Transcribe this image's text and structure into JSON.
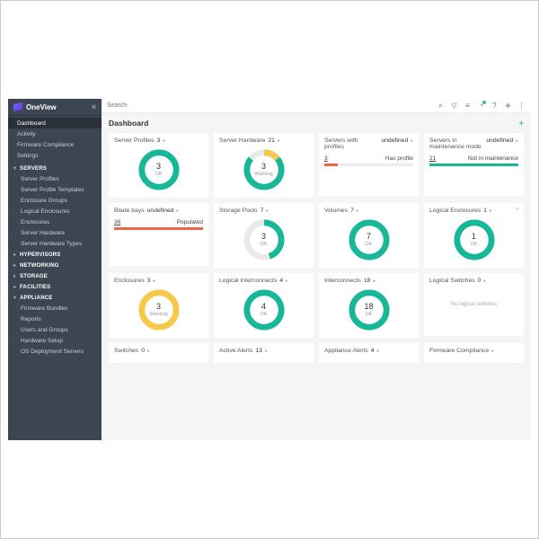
{
  "brand": "OneView",
  "search_placeholder": "Search",
  "topbar_icons": [
    "search-icon",
    "filter-icon",
    "list-icon",
    "alert-icon",
    "help-icon",
    "user-icon",
    "menu-icon"
  ],
  "sidebar": {
    "top": [
      {
        "label": "Dashboard",
        "active": true
      },
      {
        "label": "Activity"
      },
      {
        "label": "Firmware Compliance"
      },
      {
        "label": "Settings"
      }
    ],
    "sections": [
      {
        "label": "Servers",
        "items": [
          "Server Profiles",
          "Server Profile Templates",
          "Enclosure Groups",
          "Logical Enclosures",
          "Enclosures",
          "Server Hardware",
          "Server Hardware Types"
        ]
      },
      {
        "label": "Hypervisors",
        "collapsed": true,
        "items": []
      },
      {
        "label": "Networking",
        "collapsed": true,
        "items": []
      },
      {
        "label": "Storage",
        "collapsed": true,
        "items": []
      },
      {
        "label": "Facilities",
        "collapsed": true,
        "items": []
      },
      {
        "label": "Appliance",
        "items": [
          "Firmware Bundles",
          "Reports",
          "Users and Groups",
          "Hardware Setup",
          "OS Deployment Servers"
        ]
      }
    ]
  },
  "page": {
    "title": "Dashboard"
  },
  "cards": [
    {
      "kind": "ring",
      "title": "Server Profiles",
      "count": 3,
      "num": 3,
      "sub": "OK",
      "ok": 100,
      "wrn": 0
    },
    {
      "kind": "ring",
      "title": "Server Hardware",
      "count": 21,
      "num": 3,
      "sub": "Warning",
      "ok": 86,
      "wrn": 14
    },
    {
      "kind": "flat",
      "title": "Servers with profiles",
      "left_num": 3,
      "right_label": "Has profile",
      "fill_pct": 15,
      "fill_color": "err"
    },
    {
      "kind": "flat",
      "title": "Servers in maintenance mode",
      "left_num": 21,
      "right_label": "Not in maintenance",
      "fill_pct": 100,
      "fill_color": "ok"
    },
    {
      "kind": "flat",
      "title": "Blade bays",
      "left_num": 36,
      "right_label": "Populated",
      "fill_pct": 100,
      "fill_color": "err"
    },
    {
      "kind": "ring",
      "title": "Storage Pools",
      "count": 7,
      "num": 3,
      "sub": "OK",
      "ok": 45,
      "wrn": 0
    },
    {
      "kind": "ring",
      "title": "Volumes",
      "count": 7,
      "num": 7,
      "sub": "OK",
      "ok": 100,
      "wrn": 0
    },
    {
      "kind": "ring",
      "title": "Logical Enclosures",
      "count": 1,
      "num": 1,
      "sub": "OK",
      "ok": 100,
      "wrn": 0,
      "closable": true
    },
    {
      "kind": "ring",
      "title": "Enclosures",
      "count": 3,
      "num": 3,
      "sub": "Warning",
      "ok": 0,
      "wrn": 100
    },
    {
      "kind": "ring",
      "title": "Logical Interconnects",
      "count": 4,
      "num": 4,
      "sub": "OK",
      "ok": 100,
      "wrn": 0
    },
    {
      "kind": "ring",
      "title": "Interconnects",
      "count": 18,
      "num": 18,
      "sub": "OK",
      "ok": 100,
      "wrn": 0
    },
    {
      "kind": "empty",
      "title": "Logical Switches",
      "count": 0,
      "empty_text": "No logical switches"
    },
    {
      "kind": "titleonly",
      "title": "Switches",
      "count": 0
    },
    {
      "kind": "titleonly",
      "title": "Active Alerts",
      "count": 13
    },
    {
      "kind": "titleonly",
      "title": "Appliance Alerts",
      "count": 4
    },
    {
      "kind": "titleonly",
      "title": "Firmware Compliance",
      "count": ""
    }
  ],
  "chart_data": [
    {
      "type": "pie",
      "title": "Server Profiles",
      "series": [
        {
          "name": "OK",
          "value": 3
        }
      ]
    },
    {
      "type": "pie",
      "title": "Server Hardware",
      "series": [
        {
          "name": "OK",
          "value": 18
        },
        {
          "name": "Warning",
          "value": 3
        }
      ]
    },
    {
      "type": "bar",
      "title": "Servers with profiles",
      "categories": [
        "Has profile"
      ],
      "values": [
        3
      ],
      "total": 21
    },
    {
      "type": "bar",
      "title": "Servers in maintenance mode",
      "categories": [
        "Not in maintenance"
      ],
      "values": [
        21
      ],
      "total": 21
    },
    {
      "type": "bar",
      "title": "Blade bays",
      "categories": [
        "Populated"
      ],
      "values": [
        36
      ],
      "total": 36
    },
    {
      "type": "pie",
      "title": "Storage Pools",
      "series": [
        {
          "name": "OK",
          "value": 3
        },
        {
          "name": "Other",
          "value": 4
        }
      ]
    },
    {
      "type": "pie",
      "title": "Volumes",
      "series": [
        {
          "name": "OK",
          "value": 7
        }
      ]
    },
    {
      "type": "pie",
      "title": "Logical Enclosures",
      "series": [
        {
          "name": "OK",
          "value": 1
        }
      ]
    },
    {
      "type": "pie",
      "title": "Enclosures",
      "series": [
        {
          "name": "Warning",
          "value": 3
        }
      ]
    },
    {
      "type": "pie",
      "title": "Logical Interconnects",
      "series": [
        {
          "name": "OK",
          "value": 4
        }
      ]
    },
    {
      "type": "pie",
      "title": "Interconnects",
      "series": [
        {
          "name": "OK",
          "value": 18
        }
      ]
    }
  ]
}
